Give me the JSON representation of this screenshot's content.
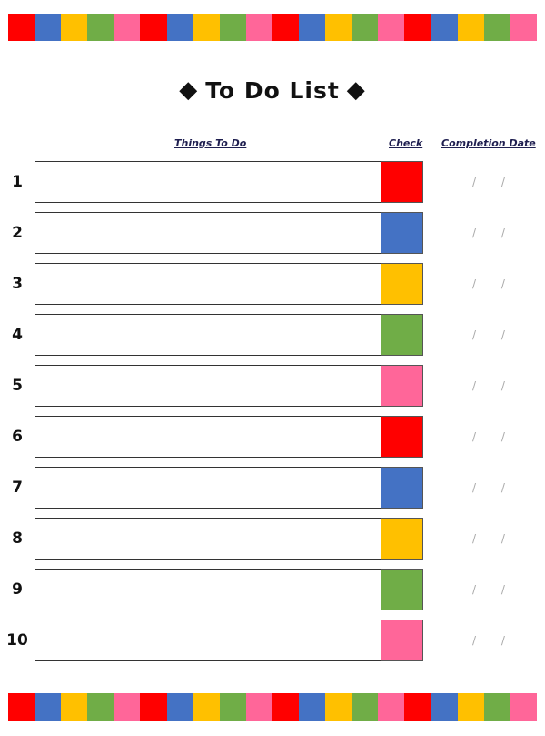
{
  "colors": {
    "red": "#ff0000",
    "blue": "#4472c4",
    "yellow": "#ffc000",
    "green": "#70ad47",
    "pink": "#ff6699"
  },
  "stripe_colors": [
    "#ff0000",
    "#4472c4",
    "#ffc000",
    "#70ad47",
    "#ff6699",
    "#ff0000",
    "#4472c4",
    "#ffc000",
    "#70ad47",
    "#ff6699",
    "#ff0000",
    "#4472c4",
    "#ffc000",
    "#70ad47",
    "#ff6699",
    "#ff0000",
    "#4472c4",
    "#ffc000",
    "#70ad47",
    "#ff6699"
  ],
  "title": {
    "left_icon": "diamond-icon",
    "text": "To Do List",
    "right_icon": "diamond-icon"
  },
  "headers": {
    "things": "Things To Do",
    "check": "Check",
    "date": "Completion Date"
  },
  "rows": [
    {
      "number": "1",
      "check_color": "#ff0000",
      "date": "/ /"
    },
    {
      "number": "2",
      "check_color": "#4472c4",
      "date": "/ /"
    },
    {
      "number": "3",
      "check_color": "#ffc000",
      "date": "/ /"
    },
    {
      "number": "4",
      "check_color": "#70ad47",
      "date": "/ /"
    },
    {
      "number": "5",
      "check_color": "#ff6699",
      "date": "/ /"
    },
    {
      "number": "6",
      "check_color": "#ff0000",
      "date": "/ /"
    },
    {
      "number": "7",
      "check_color": "#4472c4",
      "date": "/ /"
    },
    {
      "number": "8",
      "check_color": "#ffc000",
      "date": "/ /"
    },
    {
      "number": "9",
      "check_color": "#70ad47",
      "date": "/ /"
    },
    {
      "number": "10",
      "check_color": "#ff6699",
      "date": "/ /"
    }
  ]
}
